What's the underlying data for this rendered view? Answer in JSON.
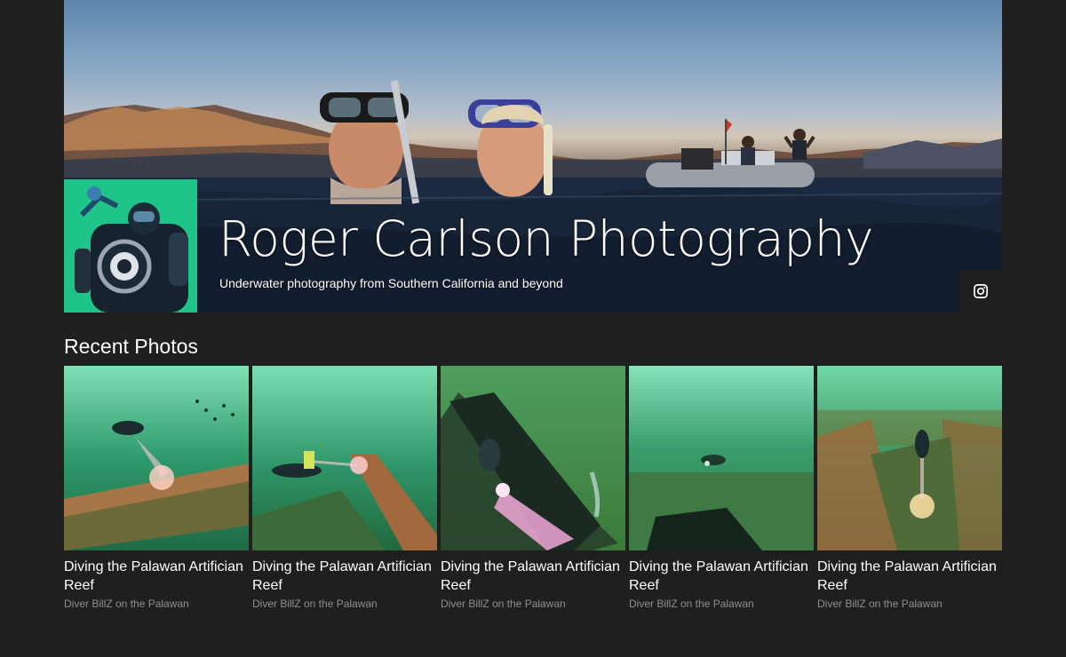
{
  "header": {
    "title": "Roger Carlson Photography",
    "subtitle": "Underwater photography from Southern California and beyond",
    "social_icon": "instagram-icon"
  },
  "recent": {
    "heading": "Recent Photos",
    "photos": [
      {
        "title": "Diving the Palawan Artifician Reef",
        "caption": "Diver BillZ on the Palawan"
      },
      {
        "title": "Diving the Palawan Artifician Reef",
        "caption": "Diver BillZ on the Palawan"
      },
      {
        "title": "Diving the Palawan Artifician Reef",
        "caption": "Diver BillZ on the Palawan"
      },
      {
        "title": "Diving the Palawan Artifician Reef",
        "caption": "Diver BillZ on the Palawan"
      },
      {
        "title": "Diving the Palawan Artifician Reef",
        "caption": "Diver BillZ on the Palawan"
      }
    ]
  },
  "colors": {
    "background": "#1f1f20",
    "text": "#ffffff",
    "caption": "#8f8f8f",
    "water_green": "#2f9a6a"
  }
}
